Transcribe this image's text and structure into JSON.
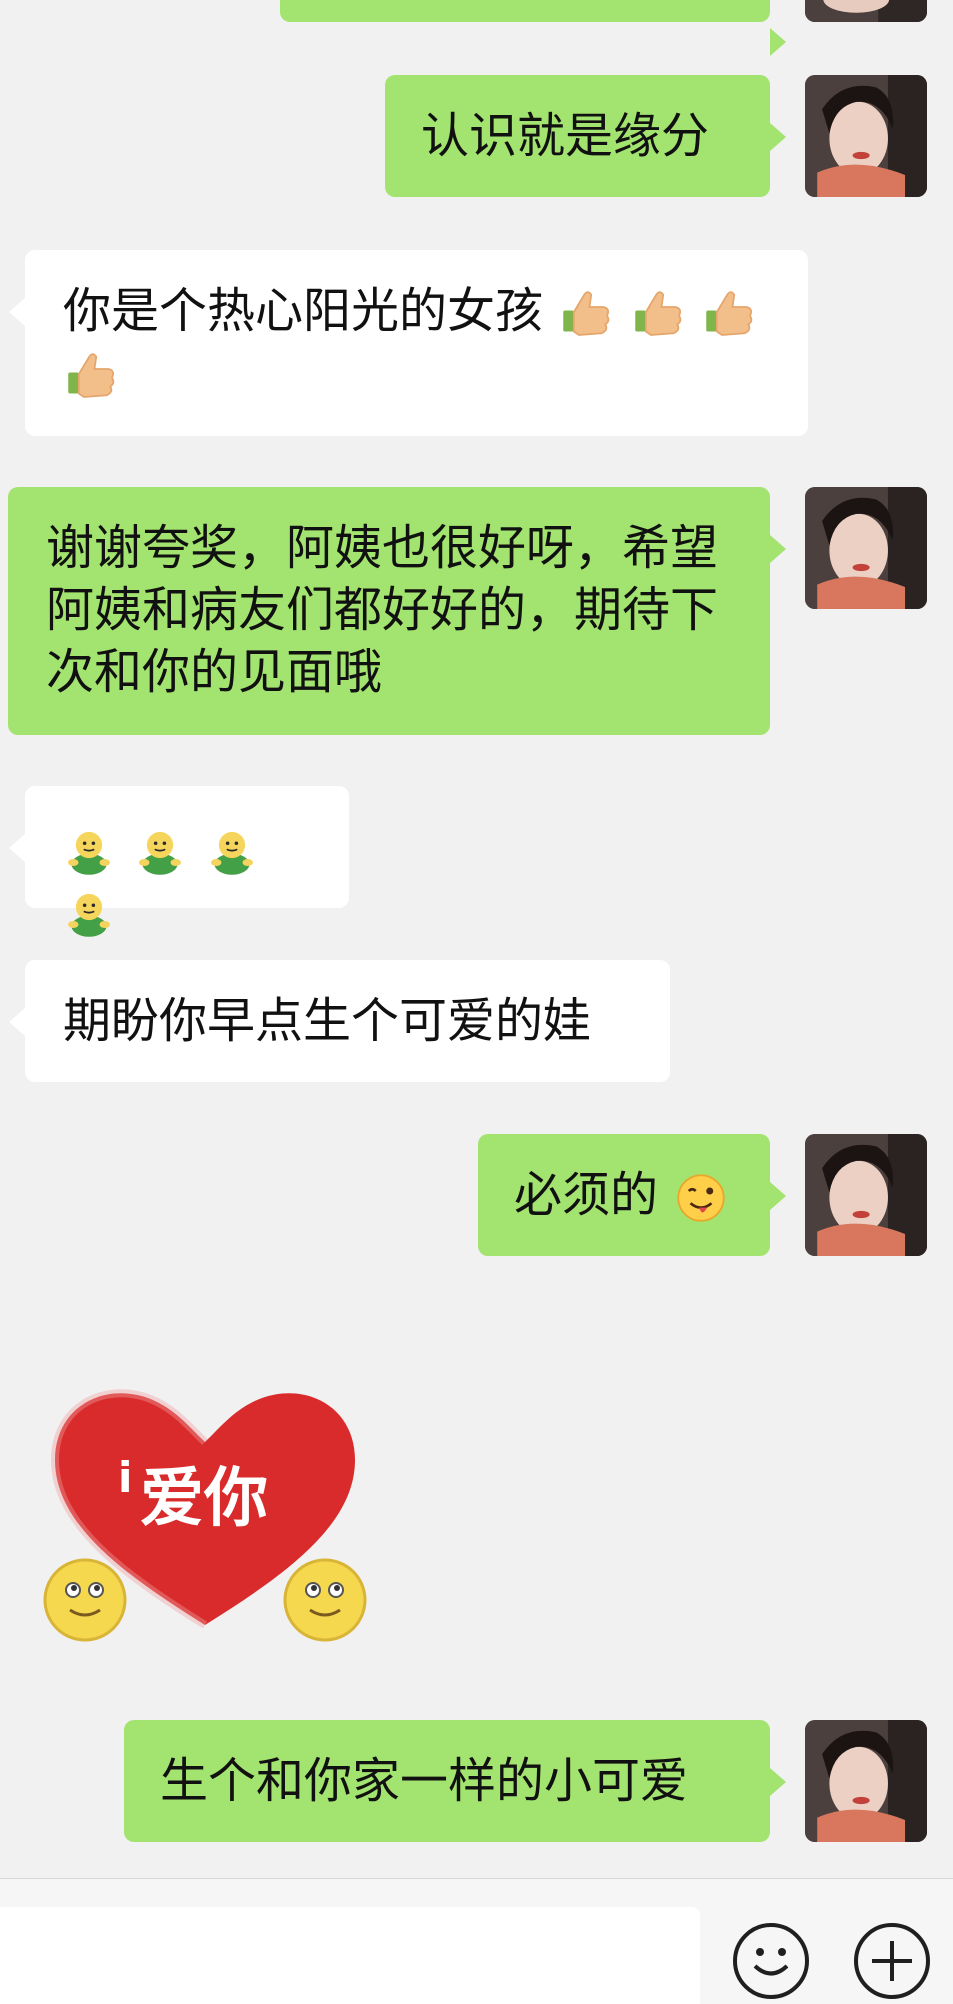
{
  "messages": [
    {
      "side": "right",
      "text": "认识就是缘分"
    },
    {
      "side": "left",
      "text": "你是个热心阳光的女孩"
    },
    {
      "side": "right",
      "text": "谢谢夸奖，阿姨也很好呀，希望阿姨和病友们都好好的，期待下次和你的见面哦"
    },
    {
      "side": "left",
      "emoji": [
        "smiling-green-figure",
        "smiling-green-figure",
        "smiling-green-figure",
        "smiling-green-figure"
      ]
    },
    {
      "side": "left",
      "text": "期盼你早点生个可爱的娃"
    },
    {
      "side": "right",
      "text": "必须的"
    },
    {
      "side": "left",
      "sticker": "ai-ni-heart-sticker"
    },
    {
      "side": "right",
      "text": "生个和你家一样的小可爱"
    }
  ],
  "sticker": {
    "text": "爱你",
    "prefix_mark": "i"
  },
  "icons": {
    "thumbs_up": "thumbs-up-icon",
    "green_figure": "smiling-green-figure-icon",
    "wink": "winking-tongue-icon",
    "emoji_button": "emoji-icon",
    "plus_button": "plus-icon"
  },
  "colors": {
    "background": "#f1f1f1",
    "outgoing_bubble": "#a3e36f",
    "incoming_bubble": "#ffffff",
    "sticker_heart": "#d92b2b"
  }
}
